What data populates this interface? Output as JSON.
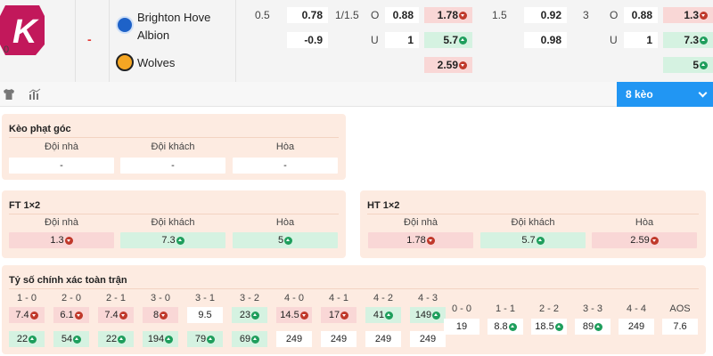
{
  "match": {
    "stub": "0",
    "result_dash": "-",
    "home_team": {
      "name_line1": "Brighton Hove",
      "name_line2": "Albion",
      "icon": "brighton-crest-icon"
    },
    "away_team": {
      "name": "Wolves",
      "icon": "wolves-crest-icon"
    },
    "row1": {
      "ah_line": "0.5",
      "ah_home": "0.78",
      "ou_line": "1/1.5",
      "ou_label": "O",
      "ou_over": "0.88",
      "x12_home": "1.78",
      "ah2_line": "1.5",
      "ah2_home": "0.92",
      "ou2_line": "3",
      "ou2_label": "O",
      "ou2_over": "0.88",
      "x12b_home": "1.3"
    },
    "row2": {
      "ah_away": "-0.9",
      "ou_label": "U",
      "ou_under": "1",
      "x12_away": "5.7",
      "ah2_away": "0.98",
      "ou2_label": "U",
      "ou2_under": "1",
      "x12b_away": "7.3"
    },
    "row3": {
      "x12_draw": "2.59",
      "x12b_draw": "5"
    }
  },
  "toolbar": {
    "jersey_icon": "jersey-icon",
    "stats_icon": "bar-chart-icon",
    "keo_label": "8 kèo",
    "keo_icon": "chevron-down-icon"
  },
  "corner": {
    "title": "Kèo phạt góc",
    "headers": [
      "Đội nhà",
      "Đội khách",
      "Hòa"
    ],
    "values": [
      "-",
      "-",
      "-"
    ]
  },
  "ft": {
    "title": "FT 1×2",
    "headers": [
      "Đội nhà",
      "Đội khách",
      "Hòa"
    ],
    "values": [
      "1.3",
      "7.3",
      "5"
    ],
    "trends": [
      "down",
      "up",
      "up"
    ]
  },
  "ht": {
    "title": "HT 1×2",
    "headers": [
      "Đội nhà",
      "Đội khách",
      "Hòa"
    ],
    "values": [
      "1.78",
      "5.7",
      "2.59"
    ],
    "trends": [
      "down",
      "up",
      "down"
    ]
  },
  "correct_score": {
    "title": "Tỷ số chính xác toàn trận",
    "home_scores": [
      "1 - 0",
      "2 - 0",
      "2 - 1",
      "3 - 0",
      "3 - 1",
      "3 - 2",
      "4 - 0",
      "4 - 1",
      "4 - 2",
      "4 - 3"
    ],
    "home_values": [
      "7.4",
      "6.1",
      "7.4",
      "8",
      "9.5",
      "23",
      "14.5",
      "17",
      "41",
      "149"
    ],
    "home_trends": [
      "down",
      "down",
      "down",
      "down",
      "none",
      "up",
      "down",
      "down",
      "up",
      "up"
    ],
    "away_values": [
      "22",
      "54",
      "22",
      "194",
      "79",
      "69",
      "249",
      "249",
      "249",
      "249"
    ],
    "away_trends": [
      "up",
      "up",
      "up",
      "up",
      "up",
      "up",
      "none",
      "none",
      "none",
      "none"
    ],
    "draw_scores": [
      "0 - 0",
      "1 - 1",
      "2 - 2",
      "3 - 3",
      "4 - 4",
      "AOS"
    ],
    "draw_values": [
      "19",
      "8.8",
      "18.5",
      "89",
      "249",
      "7.6"
    ],
    "draw_trends": [
      "none",
      "up",
      "up",
      "up",
      "none",
      "none"
    ]
  },
  "colors": {
    "accent": "#2196f3",
    "down": "#c0392b",
    "up": "#1e9e5c",
    "panel": "#fdebe1",
    "logo": "#c2185b"
  }
}
